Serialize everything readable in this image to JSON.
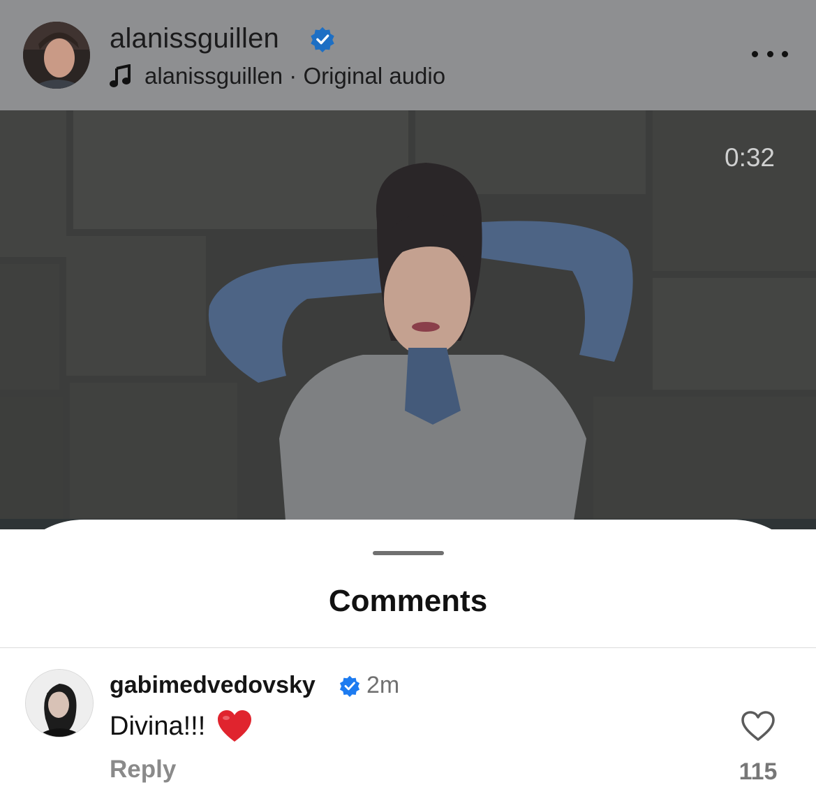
{
  "header": {
    "username": "alanissguillen",
    "audio_text": "alanissguillen · Original audio",
    "verified_icon": "verified-badge-icon",
    "more_icon": "more-horizontal-icon"
  },
  "video": {
    "timer": "0:32"
  },
  "comments_sheet": {
    "title": "Comments",
    "comments": [
      {
        "username": "gabimedvedovsky",
        "time": "2m",
        "text": "Divina!!!",
        "emoji": "red-heart",
        "reply_label": "Reply",
        "like_count": "115"
      }
    ]
  },
  "colors": {
    "header_bg": "#8e8f91",
    "verified_blue": "#1d7bf0",
    "heart_red": "#e0242e"
  }
}
